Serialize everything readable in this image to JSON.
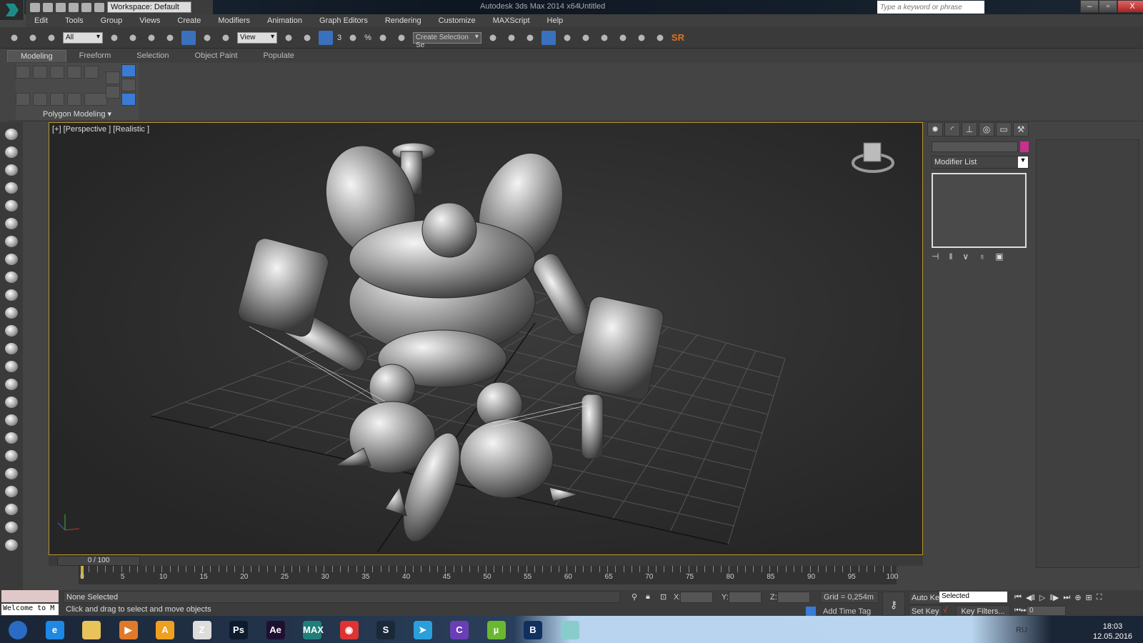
{
  "titlebar": {
    "app_title": "Autodesk 3ds Max  2014 x64",
    "doc_title": "Untitled",
    "workspace": "Workspace: Default",
    "search_placeholder": "Type a keyword or phrase",
    "min": "–",
    "max": "▫",
    "close": "X"
  },
  "menu": [
    "Edit",
    "Tools",
    "Group",
    "Views",
    "Create",
    "Modifiers",
    "Animation",
    "Graph Editors",
    "Rendering",
    "Customize",
    "MAXScript",
    "Help"
  ],
  "toolbar": {
    "selection_filter": "All",
    "ref_coord": "View",
    "named_selection": "Create Selection Se",
    "snap_labels": [
      "3",
      "%"
    ],
    "sr_label": "SR"
  },
  "ribbon": {
    "tabs": [
      "Modeling",
      "Freeform",
      "Selection",
      "Object Paint",
      "Populate"
    ],
    "active_tab": "Modeling",
    "panel_label": "Polygon Modeling ▾"
  },
  "viewport": {
    "label": "[+] [Perspective ] [Realistic ]",
    "border_color": "#b8962e"
  },
  "command_panel": {
    "tabs": [
      "create-icon",
      "modify-icon",
      "hierarchy-icon",
      "motion-icon",
      "display-icon",
      "utilities-icon"
    ],
    "object_color": "#c92f8c",
    "modifier_list": "Modifier List"
  },
  "timeline": {
    "slider": "0 / 100",
    "current_frame": 0,
    "start": 0,
    "end": 100,
    "labels": [
      0,
      5,
      10,
      15,
      20,
      25,
      30,
      35,
      40,
      45,
      50,
      55,
      60,
      65,
      70,
      75,
      80,
      85,
      90,
      95,
      100
    ]
  },
  "status": {
    "listener": "Welcome to M",
    "selection": "None Selected",
    "prompt": "Click and drag to select and move objects",
    "x_label": "X:",
    "y_label": "Y:",
    "z_label": "Z:",
    "grid": "Grid = 0,254m",
    "add_time_tag": "Add Time Tag",
    "auto_key": "Auto Key",
    "set_key": "Set Key",
    "key_mode": "Selected",
    "key_filters": "Key Filters...",
    "frame": "0"
  },
  "taskbar": {
    "apps": [
      {
        "name": "windows-start",
        "label": "",
        "color": "#2a6bc4"
      },
      {
        "name": "internet-explorer",
        "label": "e",
        "color": "#1e88e5"
      },
      {
        "name": "explorer",
        "label": "",
        "color": "#e8c25a"
      },
      {
        "name": "media-player",
        "label": "▶",
        "color": "#e07a2a"
      },
      {
        "name": "aimp",
        "label": "A",
        "color": "#f0a020"
      },
      {
        "name": "zbrush",
        "label": "Z",
        "color": "#ddd"
      },
      {
        "name": "photoshop",
        "label": "Ps",
        "color": "#0d1b2e"
      },
      {
        "name": "after-effects",
        "label": "Ae",
        "color": "#1e1030"
      },
      {
        "name": "3ds-max",
        "label": "MAX",
        "color": "#1f7f7a"
      },
      {
        "name": "chrome",
        "label": "◉",
        "color": "#d33"
      },
      {
        "name": "steam",
        "label": "S",
        "color": "#1b2838"
      },
      {
        "name": "telegram",
        "label": "➤",
        "color": "#2aa0da"
      },
      {
        "name": "app-c",
        "label": "C",
        "color": "#6a3fb5"
      },
      {
        "name": "utorrent",
        "label": "µ",
        "color": "#6ab830"
      },
      {
        "name": "battle-net",
        "label": "B",
        "color": "#103060"
      },
      {
        "name": "notes",
        "label": "",
        "color": "#8cc"
      }
    ],
    "lang": "RU",
    "time": "18:03",
    "date": "12.05.2016"
  }
}
